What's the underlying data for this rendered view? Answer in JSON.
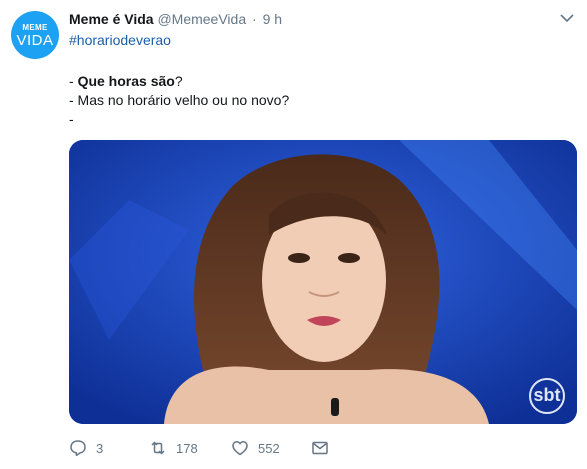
{
  "account": {
    "avatar_top": "MEME",
    "avatar_bottom": "VIDA",
    "name": "Meme é Vida",
    "handle": "@MemeeVida",
    "separator": "·",
    "time": "9 h"
  },
  "tweet": {
    "hashtag": "#horariodeverao",
    "line1_prefix": "- ",
    "line1_bold": "Que horas são",
    "line1_suffix": "?",
    "line2": "- Mas no horário velho ou no novo?",
    "line3": "-"
  },
  "media": {
    "watermark": "sbt"
  },
  "actions": {
    "replies": "3",
    "retweets": "178",
    "likes": "552"
  },
  "icons": {
    "reply": "reply-icon",
    "retweet": "retweet-icon",
    "like": "heart-icon",
    "dm": "envelope-icon",
    "menu": "chevron-down-icon"
  },
  "colors": {
    "link": "#1b5ea8",
    "muted": "#657786",
    "avatar": "#1da1f2"
  }
}
